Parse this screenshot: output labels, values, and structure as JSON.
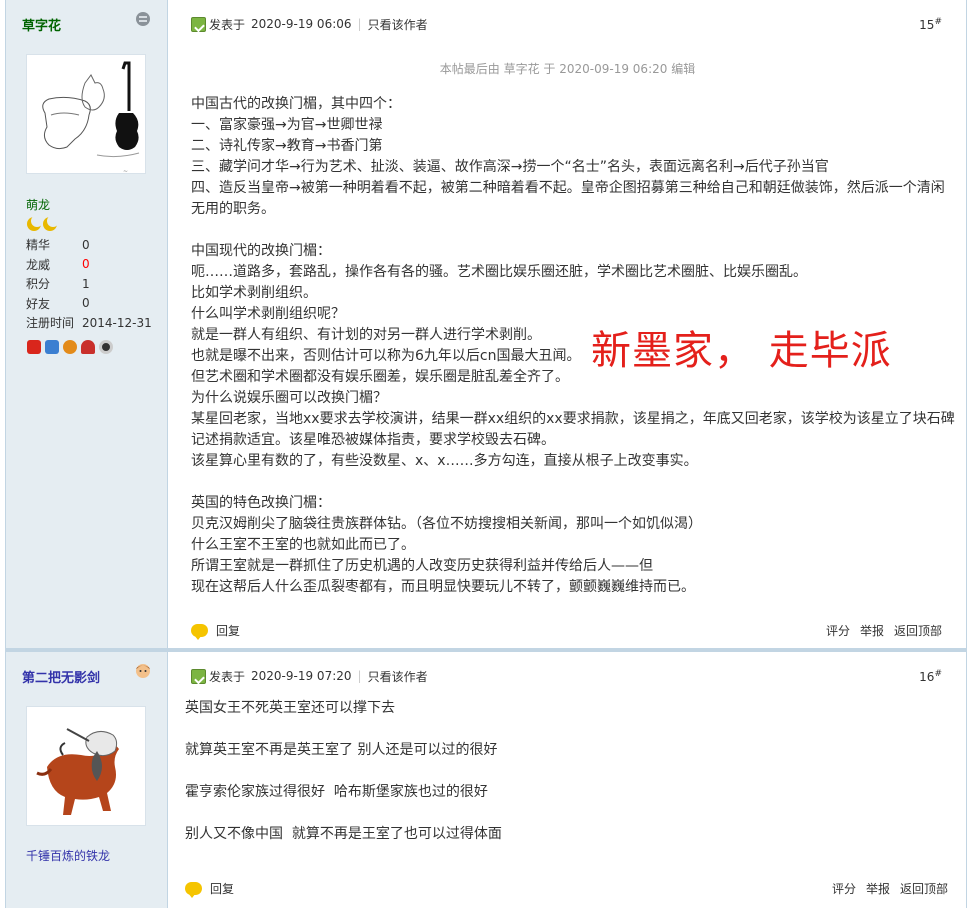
{
  "posts": [
    {
      "floor": "15",
      "author": {
        "name": "草字花",
        "rank": "萌龙",
        "registered_label": "注册时间",
        "registered": "2014-12-31"
      },
      "stats": [
        {
          "label": "精华",
          "value": "0"
        },
        {
          "label": "龙威",
          "value": "0"
        },
        {
          "label": "积分",
          "value": "1"
        },
        {
          "label": "好友",
          "value": "0"
        }
      ],
      "posted_prefix": "发表于",
      "posted": "2020-9-19 06:06",
      "only_author": "只看该作者",
      "edited_note": "本帖最后由 草字花 于 2020-09-19 06:20 编辑",
      "stamp_text": "新墨家，  走毕派",
      "lines": [
        "中国古代的改换门楣，其中四个：",
        "一、富家豪强→为官→世卿世禄",
        "二、诗礼传家→教育→书香门第",
        "三、藏学问才华→行为艺术、扯淡、装逼、故作高深→捞一个“名士”名头，表面远离名利→后代子孙当官",
        "四、造反当皇帝→被第一种明着看不起，被第二种暗着看不起。皇帝企图招募第三种给自己和朝廷做装饰，然后派一个清闲",
        "无用的职务。",
        "",
        "中国现代的改换门楣：",
        "呃……道路多，套路乱，操作各有各的骚。艺术圈比娱乐圈还脏，学术圈比艺术圈脏、比娱乐圈乱。",
        "比如学术剥削组织。",
        "什么叫学术剥削组织呢？",
        "就是一群人有组织、有计划的对另一群人进行学术剥削。",
        "也就是曝不出来，否则估计可以称为6九年以后cn国最大丑闻。",
        "但艺术圈和学术圈都没有娱乐圈差，娱乐圈是脏乱差全齐了。",
        "为什么说娱乐圈可以改换门楣？",
        "某星回老家，当地xx要求去学校演讲，结果一群xx组织的xx要求捐款，该星捐之，年底又回老家，该学校为该星立了块石碑",
        "记述捐款适宜。该星唯恐被媒体指责，要求学校毁去石碑。",
        "该星算心里有数的了，有些没数星、x、x……多方勾连，直接从根子上改变事实。",
        "",
        "英国的特色改换门楣：",
        "贝克汉姆削尖了脑袋往贵族群体钻。（各位不妨搜搜相关新闻，那叫一个如饥似渴）",
        "什么王室不王室的也就如此而已了。",
        "所谓王室就是一群抓住了历史机遇的人改变历史获得利益并传给后人——但",
        "现在这帮后人什么歪瓜裂枣都有，而且明显快要玩儿不转了，颤颤巍巍维持而已。"
      ],
      "reply_label": "回复",
      "actions": [
        "评分",
        "举报",
        "返回顶部"
      ]
    },
    {
      "floor": "16",
      "author": {
        "name": "第二把无影剑",
        "signature": "千锤百炼的铁龙"
      },
      "posted_prefix": "发表于",
      "posted": "2020-9-19 07:20",
      "only_author": "只看该作者",
      "lines": [
        "英国女王不死英王室还可以撑下去",
        "",
        "就算英王室不再是英王室了 别人还是可以过的很好",
        "",
        "霍亨索伦家族过得很好  哈布斯堡家族也过的很好",
        "",
        "别人又不像中国  就算不再是王室了也可以过得体面"
      ],
      "reply_label": "回复",
      "actions": [
        "评分",
        "举报",
        "返回顶部"
      ]
    }
  ],
  "colors": {
    "border": "#c2d5e3",
    "sidebar_bg": "#e5edf2",
    "stamp_red": "#e4201b",
    "username_green": "#006400",
    "username_blue": "#3333aa"
  },
  "icons": [
    "online-status-icon",
    "post-icon",
    "reply-icon",
    "medal-icon"
  ]
}
